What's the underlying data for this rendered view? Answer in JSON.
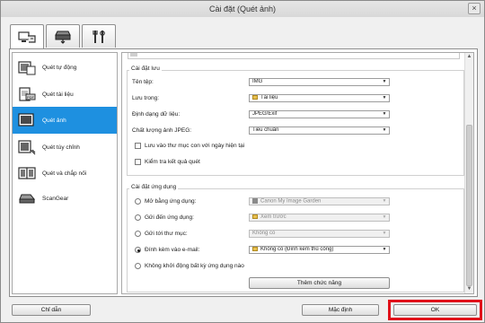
{
  "window": {
    "title": "Cài đặt (Quét ảnh)",
    "close_label": "×"
  },
  "tabs": [
    {
      "icon": "scan-from-computer-icon",
      "active": true
    },
    {
      "icon": "scan-from-panel-icon",
      "active": false
    },
    {
      "icon": "general-settings-icon",
      "active": false
    }
  ],
  "sidebar": {
    "items": [
      {
        "label": "Quét tự động",
        "icon": "auto-scan-icon"
      },
      {
        "label": "Quét tài liệu",
        "icon": "document-scan-icon"
      },
      {
        "label": "Quét ảnh",
        "icon": "photo-scan-icon",
        "selected": true
      },
      {
        "label": "Quét tùy chỉnh",
        "icon": "custom-scan-icon"
      },
      {
        "label": "Quét và chắp nối",
        "icon": "scan-and-stitch-icon"
      },
      {
        "label": "ScanGear",
        "icon": "scangear-icon"
      }
    ]
  },
  "save_settings": {
    "title": "Cài đặt lưu",
    "file_name_label": "Tên tệp:",
    "file_name_value": "IMG",
    "save_in_label": "Lưu trong:",
    "save_in_value": "Tài liệu",
    "data_format_label": "Định dạng dữ liệu:",
    "data_format_value": "JPEG/Exif",
    "jpeg_quality_label": "Chất lượng ảnh JPEG:",
    "jpeg_quality_value": "Tiêu chuẩn",
    "subfolder_label": "Lưu vào thư mục con với ngày hiện tại",
    "check_results_label": "Kiểm tra kết quả quét"
  },
  "app_settings": {
    "title": "Cài đặt ứng dụng",
    "options": [
      {
        "label": "Mở bằng ứng dụng:",
        "value": "Canon My Image Garden",
        "icon": "app",
        "checked": false,
        "enabled": false
      },
      {
        "label": "Gửi đến ứng dụng:",
        "value": "Xem trước",
        "icon": "folder",
        "checked": false,
        "enabled": false
      },
      {
        "label": "Gửi tới thư mục:",
        "value": "Không có",
        "icon": "",
        "checked": false,
        "enabled": false
      },
      {
        "label": "Đính kèm vào e-mail:",
        "value": "Không có (Đính kèm thủ công)",
        "icon": "folder",
        "checked": true,
        "enabled": true
      },
      {
        "label": "Không khởi động bất kỳ ứng dụng nào",
        "value": "",
        "icon": "",
        "checked": false,
        "enabled": false
      }
    ],
    "more_functions_label": "Thêm chức năng"
  },
  "footer": {
    "help_label": "Chỉ dẫn",
    "defaults_label": "Mặc định",
    "ok_label": "OK"
  },
  "colors": {
    "selection": "#1e90e0",
    "highlight": "#e0101a"
  }
}
